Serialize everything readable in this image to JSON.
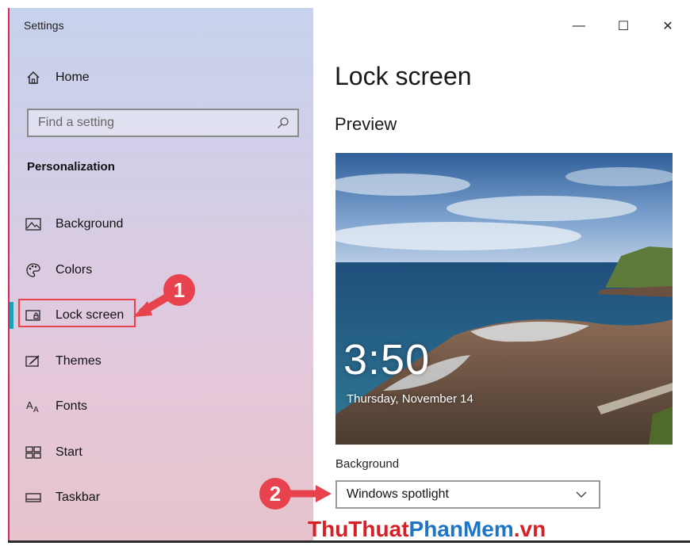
{
  "window": {
    "title": "Settings"
  },
  "controls": {
    "minimize": "—",
    "maximize": "☐",
    "close": "✕"
  },
  "sidebar": {
    "home_label": "Home",
    "search_placeholder": "Find a setting",
    "section": "Personalization",
    "items": [
      {
        "label": "Background",
        "icon": "picture-icon"
      },
      {
        "label": "Colors",
        "icon": "palette-icon"
      },
      {
        "label": "Lock screen",
        "icon": "lock-screen-icon",
        "active": true
      },
      {
        "label": "Themes",
        "icon": "themes-icon"
      },
      {
        "label": "Fonts",
        "icon": "fonts-icon"
      },
      {
        "label": "Start",
        "icon": "start-icon"
      },
      {
        "label": "Taskbar",
        "icon": "taskbar-icon"
      }
    ]
  },
  "main": {
    "title": "Lock screen",
    "preview_heading": "Preview",
    "preview_time": "3:50",
    "preview_date": "Thursday, November 14",
    "background_label": "Background",
    "background_value": "Windows spotlight"
  },
  "annotations": {
    "step1": "1",
    "step2": "2"
  },
  "watermark": {
    "part1": "ThuThuat",
    "part2": "PhanMem",
    "part3": ".vn"
  },
  "colors": {
    "accent": "#1aa3b5",
    "annotation_red": "#e8424e"
  }
}
